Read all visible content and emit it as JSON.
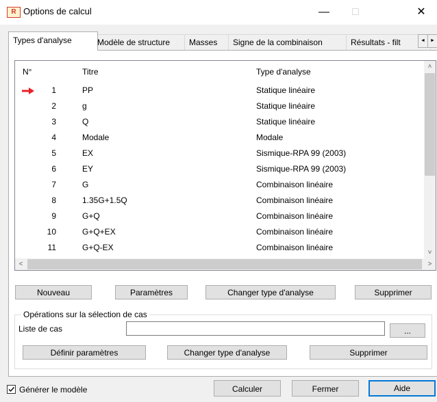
{
  "window": {
    "title": "Options de calcul",
    "app_icon_text": "R",
    "minimize_glyph": "—",
    "maximize_glyph": "□",
    "close_glyph": "✕"
  },
  "tabs": [
    {
      "label": "Types d'analyse",
      "active": true
    },
    {
      "label": "Modèle de structure",
      "active": false
    },
    {
      "label": "Masses",
      "active": false
    },
    {
      "label": "Signe de la combinaison",
      "active": false
    },
    {
      "label": "Résultats - filt",
      "active": false
    }
  ],
  "tab_scroll": {
    "left": "◄",
    "right": "►"
  },
  "table": {
    "columns": [
      "N°",
      "Titre",
      "Type d'analyse"
    ],
    "selected_row": 0,
    "rows": [
      {
        "num": "1",
        "title": "PP",
        "type": "Statique linéaire"
      },
      {
        "num": "2",
        "title": "g",
        "type": "Statique linéaire"
      },
      {
        "num": "3",
        "title": "Q",
        "type": "Statique linéaire"
      },
      {
        "num": "4",
        "title": "Modale",
        "type": "Modale"
      },
      {
        "num": "5",
        "title": "EX",
        "type": "Sismique-RPA 99 (2003)"
      },
      {
        "num": "6",
        "title": "EY",
        "type": "Sismique-RPA 99 (2003)"
      },
      {
        "num": "7",
        "title": "G",
        "type": "Combinaison linéaire"
      },
      {
        "num": "8",
        "title": "1.35G+1.5Q",
        "type": "Combinaison linéaire"
      },
      {
        "num": "9",
        "title": "G+Q",
        "type": "Combinaison linéaire"
      },
      {
        "num": "10",
        "title": "G+Q+EX",
        "type": "Combinaison linéaire"
      },
      {
        "num": "11",
        "title": "G+Q-EX",
        "type": "Combinaison linéaire"
      }
    ]
  },
  "scroll": {
    "up": "˄",
    "down": "˅",
    "left": "<",
    "right": ">"
  },
  "actions": {
    "new": "Nouveau",
    "parameters": "Paramètres",
    "change_type": "Changer type d'analyse",
    "delete": "Supprimer"
  },
  "selection_group": {
    "legend": "Opérations sur la sélection de cas",
    "case_list_label": "Liste de cas",
    "case_list_value": "",
    "browse": "...",
    "define_params": "Définir paramètres",
    "change_type": "Changer type d'analyse",
    "delete": "Supprimer"
  },
  "footer": {
    "generate_model_label": "Générer le modèle",
    "generate_model_checked": true,
    "calculate": "Calculer",
    "close": "Fermer",
    "help": "Aide"
  },
  "colors": {
    "selection_arrow": "#e8202a",
    "default_button_border": "#0078d7"
  }
}
